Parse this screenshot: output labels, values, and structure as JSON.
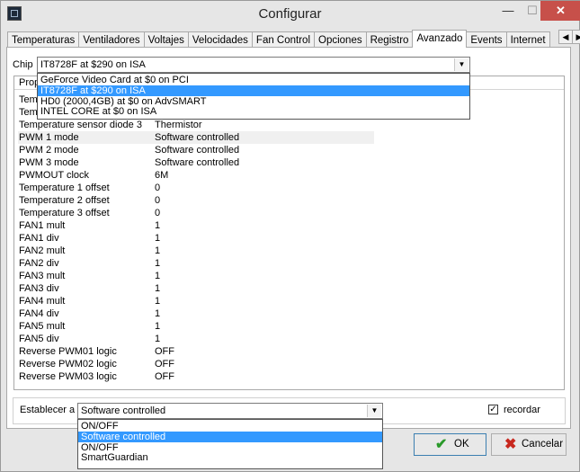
{
  "window": {
    "title": "Configurar",
    "minimize": "—",
    "maximize": "☐",
    "close": "✕"
  },
  "tabs": [
    "Temperaturas",
    "Ventiladores",
    "Voltajes",
    "Velocidades",
    "Fan Control",
    "Opciones",
    "Registro",
    "Avanzado",
    "Events",
    "Internet"
  ],
  "active_tab": "Avanzado",
  "chip": {
    "label": "Chip",
    "value": "IT8728F at $290 on ISA",
    "options": [
      "GeForce Video Card at $0 on PCI",
      "IT8728F at $290 on ISA",
      "HD0 (2000,4GB) at $0 on AdvSMART",
      "INTEL CORE at $0 on ISA"
    ]
  },
  "list": {
    "columns": [
      "Prop",
      ""
    ],
    "rows": [
      {
        "name": "Tem",
        "value": ""
      },
      {
        "name": "Tem",
        "value": ""
      },
      {
        "name": "Temperature sensor diode 3",
        "value": "Thermistor"
      },
      {
        "name": "PWM 1 mode",
        "value": "Software controlled"
      },
      {
        "name": "PWM 2 mode",
        "value": "Software controlled"
      },
      {
        "name": "PWM 3 mode",
        "value": "Software controlled"
      },
      {
        "name": "PWMOUT clock",
        "value": "6M"
      },
      {
        "name": "Temperature 1 offset",
        "value": "0"
      },
      {
        "name": "Temperature 2 offset",
        "value": "0"
      },
      {
        "name": "Temperature 3 offset",
        "value": "0"
      },
      {
        "name": "FAN1 mult",
        "value": "1"
      },
      {
        "name": "FAN1 div",
        "value": "1"
      },
      {
        "name": "FAN2 mult",
        "value": "1"
      },
      {
        "name": "FAN2 div",
        "value": "1"
      },
      {
        "name": "FAN3 mult",
        "value": "1"
      },
      {
        "name": "FAN3 div",
        "value": "1"
      },
      {
        "name": "FAN4 mult",
        "value": "1"
      },
      {
        "name": "FAN4 div",
        "value": "1"
      },
      {
        "name": "FAN5 mult",
        "value": "1"
      },
      {
        "name": "FAN5 div",
        "value": "1"
      },
      {
        "name": "Reverse PWM01 logic",
        "value": "OFF"
      },
      {
        "name": "Reverse PWM02 logic",
        "value": "OFF"
      },
      {
        "name": "Reverse PWM03 logic",
        "value": "OFF"
      }
    ]
  },
  "set": {
    "label": "Establecer a",
    "value": "Software controlled",
    "options": [
      "ON/OFF",
      "Software controlled",
      "ON/OFF",
      "SmartGuardian"
    ],
    "remember_label": "recordar",
    "remember_checked": "✓"
  },
  "buttons": {
    "ok": "OK",
    "cancel": "Cancelar"
  }
}
